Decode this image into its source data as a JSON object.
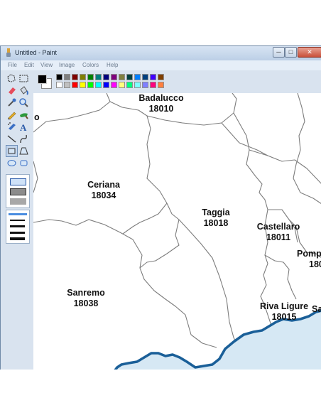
{
  "window": {
    "title": "Untitled - Paint",
    "controls": {
      "minimize": "─",
      "maximize": "□",
      "close": "✕"
    }
  },
  "menu": [
    "File",
    "Edit",
    "View",
    "Image",
    "Colors",
    "Help"
  ],
  "palette": {
    "foreground": "#000000",
    "background": "#ffffff",
    "row1": [
      "#000000",
      "#7f7f7f",
      "#7f0000",
      "#7f7f00",
      "#007f00",
      "#007f7f",
      "#00007f",
      "#7f007f",
      "#7f7f3f",
      "#003f3f",
      "#007fff",
      "#003f7f",
      "#3f00ff",
      "#7f3f00"
    ],
    "row2": [
      "#ffffff",
      "#c0c0c0",
      "#ff0000",
      "#ffff00",
      "#00ff00",
      "#00ffff",
      "#0000ff",
      "#ff00ff",
      "#ffff7f",
      "#00ff7f",
      "#7fffff",
      "#7f7fff",
      "#ff007f",
      "#ff7f3f"
    ]
  },
  "tools": [
    "free-select-icon",
    "rect-select-icon",
    "eraser-icon",
    "fill-icon",
    "eyedropper-icon",
    "magnifier-icon",
    "pencil-icon",
    "brush-icon",
    "airbrush-icon",
    "text-icon",
    "line-icon",
    "curve-icon",
    "rectangle-icon",
    "polygon-icon",
    "ellipse-icon",
    "rounded-rect-icon"
  ],
  "map": {
    "sea_color": "#d6e8f4",
    "coast_color": "#1a5f98",
    "labels": [
      {
        "name": "Badalucco",
        "code": "18010"
      },
      {
        "name": "o",
        "code": ""
      },
      {
        "name": "Ceriana",
        "code": "18034"
      },
      {
        "name": "Taggia",
        "code": "18018"
      },
      {
        "name": "Castellaro",
        "code": "18011"
      },
      {
        "name": "Pomp",
        "code": "180"
      },
      {
        "name": "Sanremo",
        "code": "18038"
      },
      {
        "name": "Riva Ligure",
        "code": "18015"
      },
      {
        "name": "Sa",
        "code": ""
      }
    ]
  }
}
